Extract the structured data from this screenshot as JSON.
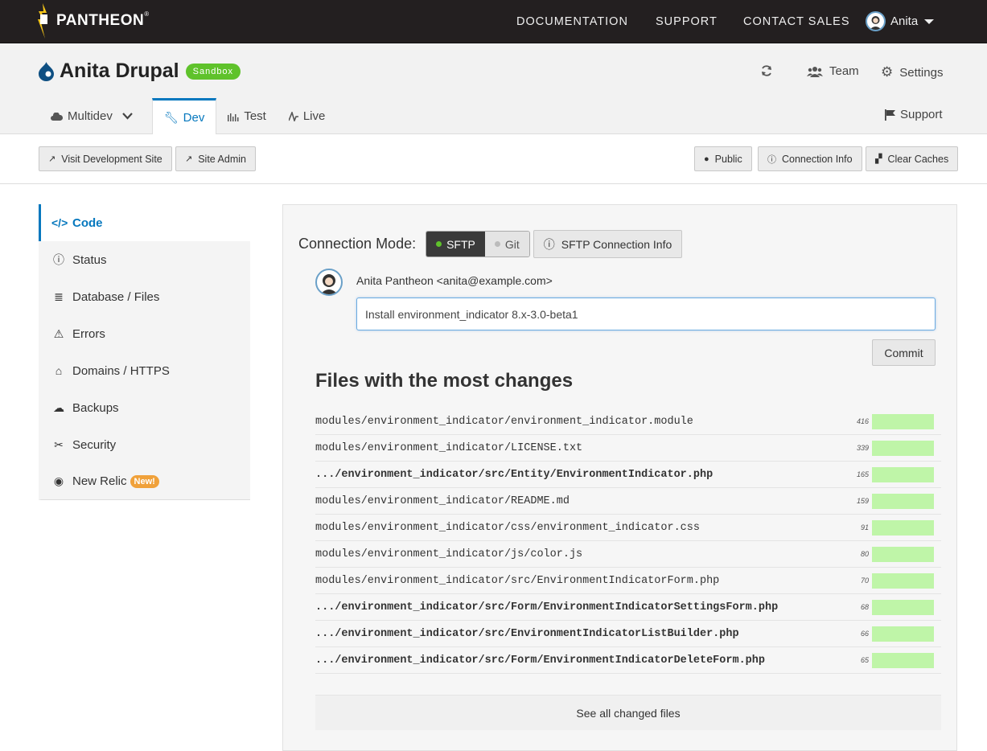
{
  "brand": {
    "name": "PANTHEON",
    "reg": "®"
  },
  "topnav": {
    "documentation": "DOCUMENTATION",
    "support": "SUPPORT",
    "contact_sales": "CONTACT SALES",
    "user": "Anita"
  },
  "site": {
    "name": "Anita Drupal",
    "plan_badge": "Sandbox"
  },
  "header_actions": {
    "team": "Team",
    "settings": "Settings",
    "support": "Support"
  },
  "env_tabs": [
    {
      "label": "Multidev",
      "icon": "cloud-icon"
    },
    {
      "label": "Dev",
      "icon": "wrench-icon"
    },
    {
      "label": "Test",
      "icon": "chart-icon"
    },
    {
      "label": "Live",
      "icon": "pulse-icon"
    }
  ],
  "actionbar": {
    "visit": "Visit Development Site",
    "site_admin": "Site Admin",
    "public": "Public",
    "connection_info": "Connection Info",
    "clear_caches": "Clear Caches"
  },
  "sidebar": {
    "items": [
      {
        "label": "Code",
        "icon": "code-icon"
      },
      {
        "label": "Status",
        "icon": "info-icon"
      },
      {
        "label": "Database / Files",
        "icon": "database-icon"
      },
      {
        "label": "Errors",
        "icon": "warning-icon"
      },
      {
        "label": "Domains / HTTPS",
        "icon": "home-icon"
      },
      {
        "label": "Backups",
        "icon": "cloud-upload-icon"
      },
      {
        "label": "Security",
        "icon": "tools-icon"
      },
      {
        "label": "New Relic",
        "icon": "eye-icon",
        "badge": "New!"
      }
    ]
  },
  "connection": {
    "label": "Connection Mode:",
    "sftp": "SFTP",
    "git": "Git",
    "sftp_info": "SFTP Connection Info",
    "active_color": "#5fc22b"
  },
  "commit": {
    "author": "Anita Pantheon <anita@example.com>",
    "message": "Install environment_indicator 8.x-3.0-beta1",
    "button": "Commit"
  },
  "files": {
    "title": "Files with the most changes",
    "rows": [
      {
        "name": "modules/environment_indicator/environment_indicator.module",
        "count": "416",
        "bold": false
      },
      {
        "name": "modules/environment_indicator/LICENSE.txt",
        "count": "339",
        "bold": false
      },
      {
        "name": ".../environment_indicator/src/Entity/EnvironmentIndicator.php",
        "count": "165",
        "bold": true
      },
      {
        "name": "modules/environment_indicator/README.md",
        "count": "159",
        "bold": false
      },
      {
        "name": "modules/environment_indicator/css/environment_indicator.css",
        "count": "91",
        "bold": false
      },
      {
        "name": "modules/environment_indicator/js/color.js",
        "count": "80",
        "bold": false
      },
      {
        "name": "modules/environment_indicator/src/EnvironmentIndicatorForm.php",
        "count": "70",
        "bold": false
      },
      {
        "name": ".../environment_indicator/src/Form/EnvironmentIndicatorSettingsForm.php",
        "count": "68",
        "bold": true
      },
      {
        "name": ".../environment_indicator/src/EnvironmentIndicatorListBuilder.php",
        "count": "66",
        "bold": true
      },
      {
        "name": ".../environment_indicator/src/Form/EnvironmentIndicatorDeleteForm.php",
        "count": "65",
        "bold": true
      }
    ],
    "see_all": "See all changed files"
  }
}
